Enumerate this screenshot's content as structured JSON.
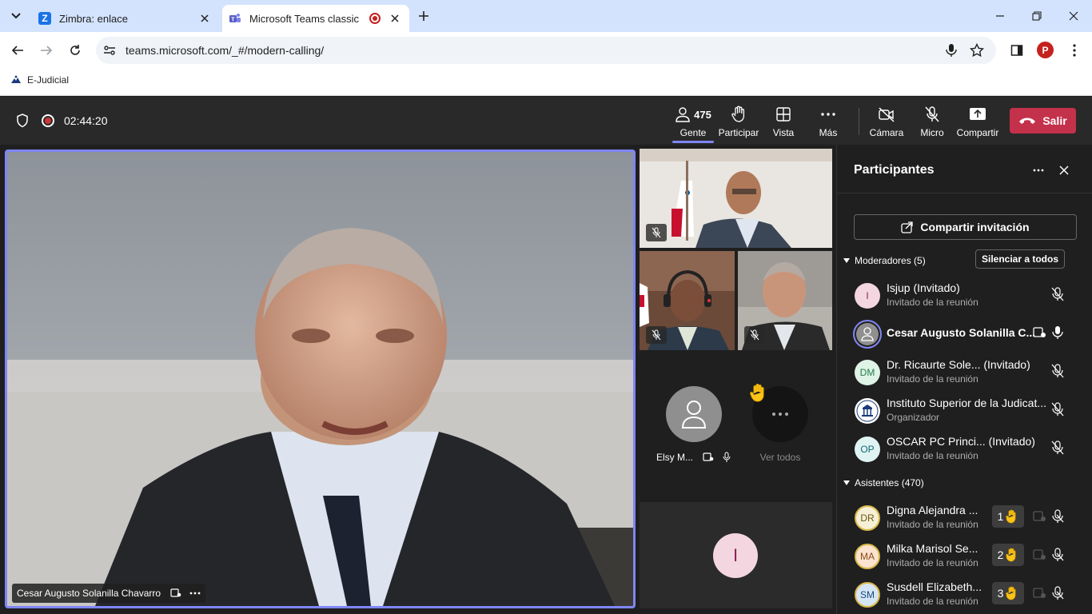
{
  "browser": {
    "tabs": [
      {
        "title": "Zimbra: enlace",
        "favicon": "zimbra-z-icon"
      },
      {
        "title": "Microsoft Teams classic",
        "favicon": "teams-icon",
        "recording": true
      }
    ],
    "url": "teams.microsoft.com/_#/modern-calling/",
    "profile_initial": "P",
    "bookmark": "E-Judicial"
  },
  "meeting": {
    "elapsed": "02:44:20",
    "people_count": "475",
    "controls": {
      "people": "Gente",
      "participate": "Participar",
      "view": "Vista",
      "more": "Más",
      "camera": "Cámara",
      "mic": "Micro",
      "share": "Compartir",
      "leave": "Salir"
    },
    "main_speaker": "Cesar Augusto Solanilla Chavarro",
    "tiles": {
      "elsy": "Elsy M...",
      "see_all": "Ver todos",
      "bottom_initial": "I"
    }
  },
  "panel": {
    "title": "Participantes",
    "share_invite": "Compartir invitación",
    "moderators_header": "Moderadores (5)",
    "mute_all": "Silenciar a todos",
    "attendees_header": "Asistentes (470)",
    "moderators": [
      {
        "initials": "I",
        "name": "Isjup (Invitado)",
        "role": "Invitado de la reunión"
      },
      {
        "initials": "",
        "name": "Cesar Augusto Solanilla C...",
        "role": ""
      },
      {
        "initials": "DM",
        "name": "Dr. Ricaurte Sole... (Invitado)",
        "role": "Invitado de la reunión"
      },
      {
        "initials": "",
        "name": "Instituto Superior de la Judicat...",
        "role": "Organizador"
      },
      {
        "initials": "OP",
        "name": "OSCAR PC Princi... (Invitado)",
        "role": "Invitado de la reunión"
      }
    ],
    "attendees": [
      {
        "initials": "DR",
        "name": "Digna Alejandra ... ",
        "role": "Invitado de la reunión",
        "hand_order": "1"
      },
      {
        "initials": "MA",
        "name": "Milka Marisol Se... ",
        "role": "Invitado de la reunión",
        "hand_order": "2"
      },
      {
        "initials": "SM",
        "name": "Susdell Elizabeth... ",
        "role": "Invitado de la reunión",
        "hand_order": "3"
      }
    ]
  },
  "colors": {
    "accent": "#7f85f5",
    "leave": "#c4314b",
    "tab_strip": "#d3e3fd",
    "teams_bg": "#1f1f1f"
  }
}
